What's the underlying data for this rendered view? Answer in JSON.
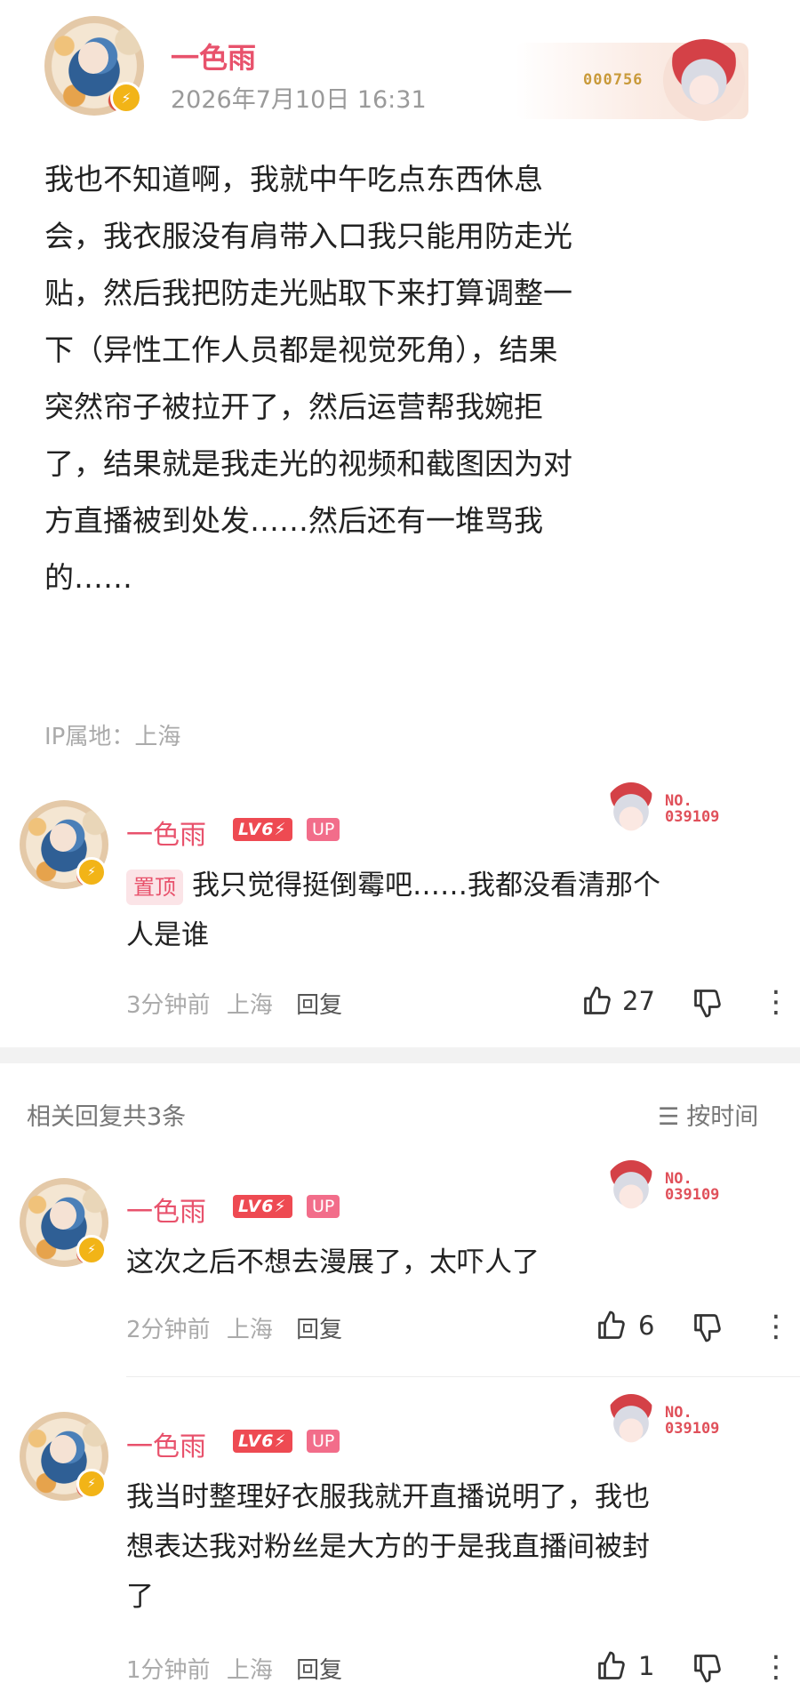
{
  "post": {
    "author": "一色雨",
    "datetime": "2026年7月10日 16:31",
    "card_number": "000756",
    "content_lines": [
      "我也不知道啊，我就中午吃点东西休息",
      "会，我衣服没有肩带入口我只能用防走光",
      "贴，然后我把防走光贴取下来打算调整一",
      "下（异性工作人员都是视觉死角），结果",
      "突然帘子被拉开了，然后运营帮我婉拒",
      "了，结果就是我走光的视频和截图因为对",
      "方直播被到处发……然后还有一堆骂我",
      "的……"
    ],
    "ip_location": "IP属地：上海"
  },
  "badges": {
    "level": "LV6⚡",
    "up": "UP",
    "fan_label": "NO.",
    "fan_number": "039109"
  },
  "top_comment": {
    "author": "一色雨",
    "pin_label": "置顶",
    "text_lines": [
      "我只觉得挺倒霉吧……我都没看清那个",
      "人是谁"
    ],
    "time": "3分钟前",
    "location": "上海",
    "reply_label": "回复",
    "likes": "27"
  },
  "replies_header": {
    "count_label": "相关回复共3条",
    "sort_label": "按时间"
  },
  "replies": [
    {
      "author": "一色雨",
      "text_lines": [
        "这次之后不想去漫展了，太吓人了"
      ],
      "time": "2分钟前",
      "location": "上海",
      "reply_label": "回复",
      "likes": "6"
    },
    {
      "author": "一色雨",
      "text_lines": [
        "我当时整理好衣服我就开直播说明了，我也",
        "想表达我对粉丝是大方的于是我直播间被封",
        "了"
      ],
      "time": "1分钟前",
      "location": "上海",
      "reply_label": "回复",
      "likes": "1"
    }
  ],
  "icons": {
    "like": "thumb-up-icon",
    "dislike": "thumb-down-icon",
    "more": "more-vertical-icon",
    "sort": "sort-lines-icon",
    "badge": "lightning-icon"
  },
  "colors": {
    "accent": "#e8526c",
    "level_badge": "#ee4a52",
    "up_badge": "#f26d8a"
  }
}
